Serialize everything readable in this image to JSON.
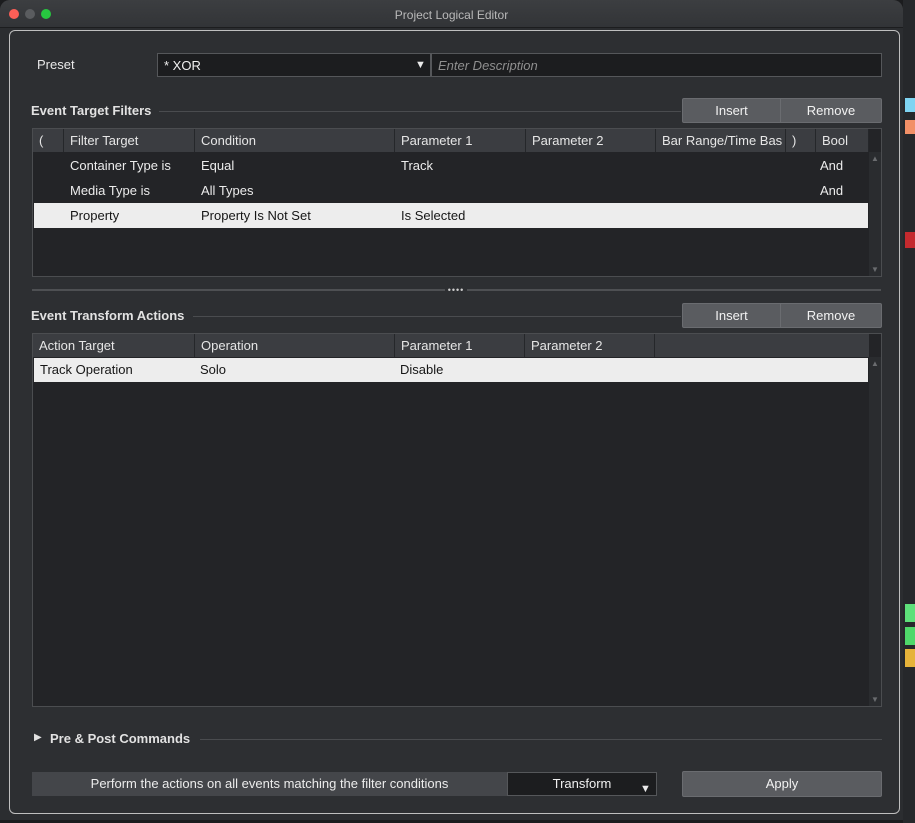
{
  "window": {
    "title": "Project Logical Editor"
  },
  "preset": {
    "label": "Preset",
    "value": "* XOR",
    "description_placeholder": "Enter Description"
  },
  "filters": {
    "title": "Event Target Filters",
    "insert_label": "Insert",
    "remove_label": "Remove",
    "columns": [
      "(",
      "Filter Target",
      "Condition",
      "Parameter 1",
      "Parameter 2",
      "Bar Range/Time Bas",
      ")",
      "Bool"
    ],
    "rows": [
      {
        "target": "Container Type is",
        "condition": "Equal",
        "param1": "Track",
        "param2": "",
        "bool": "And"
      },
      {
        "target": "Media Type is",
        "condition": "All Types",
        "param1": "",
        "param2": "",
        "bool": "And"
      },
      {
        "target": "Property",
        "condition": "Property Is Not Set",
        "param1": "Is Selected",
        "param2": "",
        "bool": ""
      }
    ]
  },
  "actions": {
    "title": "Event Transform Actions",
    "insert_label": "Insert",
    "remove_label": "Remove",
    "columns": [
      "Action Target",
      "Operation",
      "Parameter 1",
      "Parameter 2"
    ],
    "rows": [
      {
        "target": "Track Operation",
        "operation": "Solo",
        "param1": "Disable",
        "param2": ""
      }
    ]
  },
  "prepost": {
    "label": "Pre & Post Commands"
  },
  "footer": {
    "perform_text": "Perform the actions on all events matching the filter conditions",
    "function_value": "Transform",
    "apply_label": "Apply"
  },
  "colors": {
    "accent_selected_row": "#ededed",
    "close": "#fe5f57",
    "maximize": "#27c840",
    "bg_marks": [
      "#7fd4f2",
      "#f29067",
      "#c42a2e",
      "#5ee07a",
      "#4fd86a",
      "#e6b33a"
    ]
  },
  "icons": {
    "dropdown": "chevron-down-icon",
    "disclosure": "triangle-right-icon"
  }
}
